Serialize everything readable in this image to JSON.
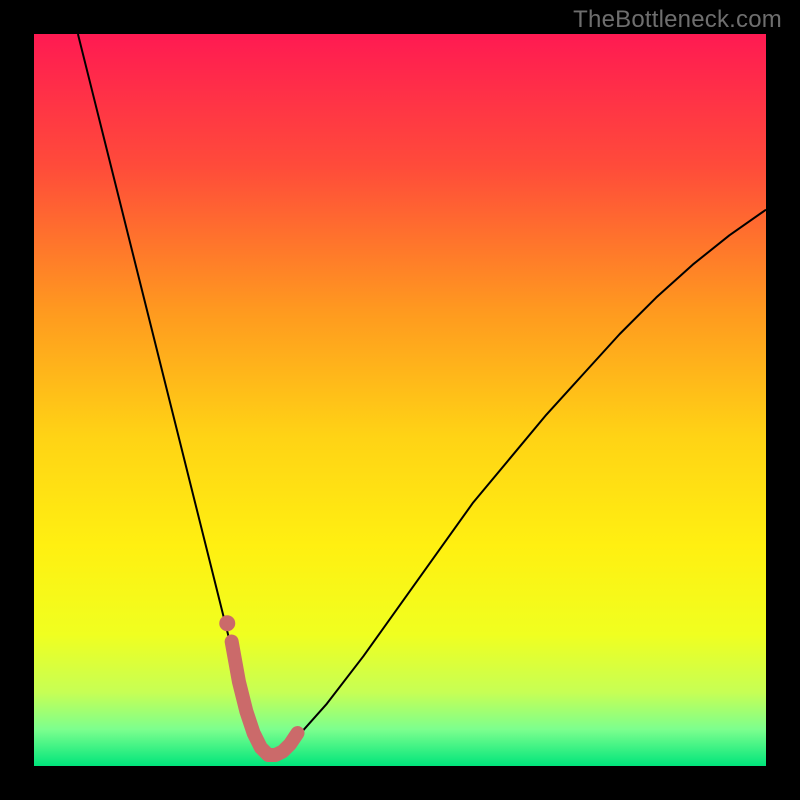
{
  "watermark": "TheBottleneck.com",
  "chart_data": {
    "type": "line",
    "title": "",
    "xlabel": "",
    "ylabel": "",
    "xlim": [
      0,
      100
    ],
    "ylim": [
      0,
      100
    ],
    "grid": false,
    "legend": false,
    "background": {
      "type": "vertical_gradient",
      "stops": [
        {
          "pos": 0.0,
          "color": "#ff1a52"
        },
        {
          "pos": 0.18,
          "color": "#ff4b3a"
        },
        {
          "pos": 0.38,
          "color": "#ff9a1f"
        },
        {
          "pos": 0.55,
          "color": "#ffd315"
        },
        {
          "pos": 0.7,
          "color": "#fff011"
        },
        {
          "pos": 0.82,
          "color": "#f0ff20"
        },
        {
          "pos": 0.9,
          "color": "#c6ff55"
        },
        {
          "pos": 0.95,
          "color": "#7cff8e"
        },
        {
          "pos": 1.0,
          "color": "#00e57b"
        }
      ]
    },
    "series": [
      {
        "name": "curve",
        "stroke": "#000000",
        "x": [
          6,
          8,
          10,
          12,
          14,
          16,
          18,
          20,
          22,
          24,
          26,
          27.5,
          29,
          30,
          31,
          32,
          33,
          34,
          36,
          40,
          45,
          50,
          55,
          60,
          65,
          70,
          75,
          80,
          85,
          90,
          95,
          100
        ],
        "y": [
          100,
          92,
          84,
          76,
          68,
          60,
          52,
          44,
          36,
          28,
          20,
          14,
          9,
          5,
          2.5,
          1.5,
          1.5,
          2,
          4,
          8.5,
          15,
          22,
          29,
          36,
          42,
          48,
          53.5,
          59,
          64,
          68.5,
          72.5,
          76
        ]
      },
      {
        "name": "highlight_band",
        "stroke": "#cb6a6a",
        "stroke_width": 14,
        "linecap": "round",
        "x": [
          27,
          28,
          29,
          30,
          31,
          32,
          33,
          34,
          35,
          36
        ],
        "y": [
          17,
          11.5,
          7.5,
          4.5,
          2.5,
          1.5,
          1.5,
          2,
          3,
          4.5
        ]
      },
      {
        "name": "highlight_dot",
        "type": "scatter",
        "fill": "#cb6a6a",
        "x": [
          26.4
        ],
        "y": [
          19.5
        ],
        "r": 8
      }
    ]
  }
}
